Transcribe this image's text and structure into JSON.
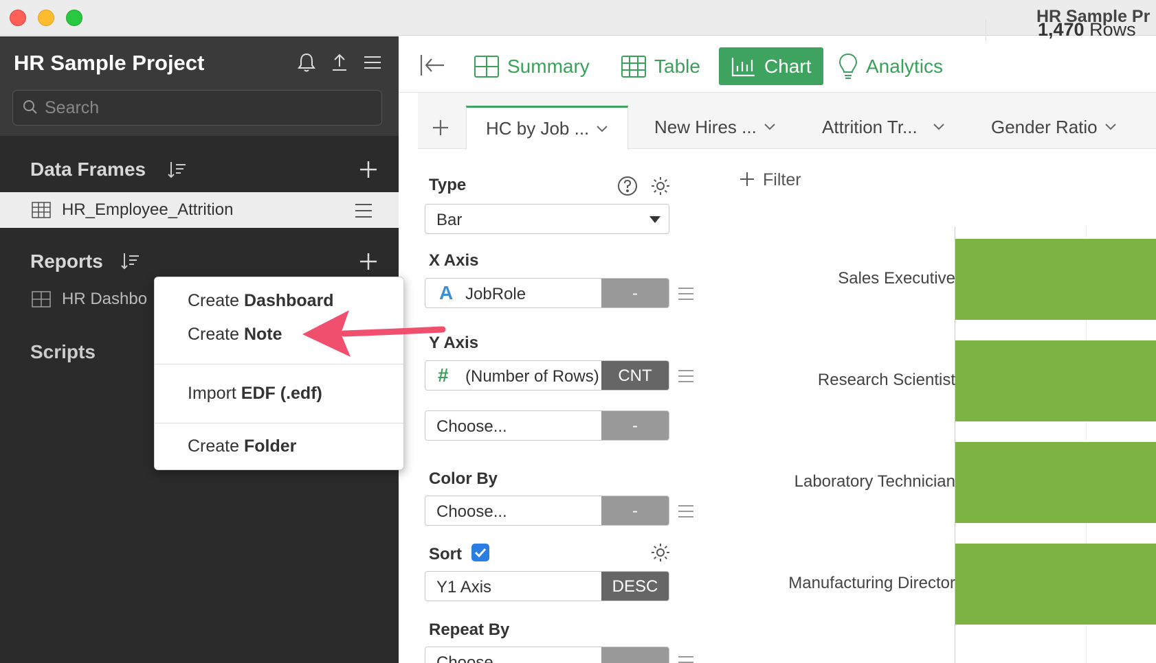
{
  "window": {
    "title": "HR Sample Pr"
  },
  "sidebar": {
    "project_title": "HR Sample Project",
    "search_placeholder": "Search",
    "data_frames": {
      "title": "Data Frames",
      "items": [
        {
          "label": "HR_Employee_Attrition"
        }
      ]
    },
    "reports": {
      "title": "Reports",
      "items": [
        {
          "label": "HR Dashbo"
        }
      ]
    },
    "scripts": {
      "title": "Scripts"
    }
  },
  "context_menu": {
    "items": [
      {
        "prefix": "Create ",
        "bold": "Dashboard"
      },
      {
        "prefix": "Create ",
        "bold": "Note"
      },
      {
        "prefix": "Import ",
        "bold": "EDF (.edf)"
      },
      {
        "prefix": "Create ",
        "bold": "Folder"
      }
    ]
  },
  "toolbar": {
    "summary": "Summary",
    "table": "Table",
    "chart": "Chart",
    "analytics": "Analytics",
    "rows_count": "1,470",
    "rows_label": "Rows"
  },
  "tabs": [
    {
      "label": "HC by Job ..."
    },
    {
      "label": "New Hires ..."
    },
    {
      "label": "Attrition Tr..."
    },
    {
      "label": "Gender Ratio"
    }
  ],
  "config": {
    "type_label": "Type",
    "type_value": "Bar",
    "x_axis_label": "X Axis",
    "x_axis_column": "JobRole",
    "x_axis_agg": "-",
    "y_axis_label": "Y Axis",
    "y_axis_column": "(Number of Rows)",
    "y_axis_agg": "CNT",
    "y2_placeholder": "Choose...",
    "y2_agg": "-",
    "color_by_label": "Color By",
    "color_by_placeholder": "Choose...",
    "color_by_agg": "-",
    "sort_label": "Sort",
    "sort_value": "Y1 Axis",
    "sort_order": "DESC",
    "repeat_by_label": "Repeat By",
    "repeat_by_placeholder": "Choose..."
  },
  "filter": {
    "label": "Filter"
  },
  "chart_data": {
    "type": "bar",
    "orientation": "horizontal",
    "categories": [
      "Sales Executive",
      "Research Scientist",
      "Laboratory Technician",
      "Manufacturing Director"
    ],
    "colors": {
      "bar": "#7cb342"
    }
  },
  "colors": {
    "accent": "#3ea35f",
    "annotation_arrow": "#f0506e"
  }
}
